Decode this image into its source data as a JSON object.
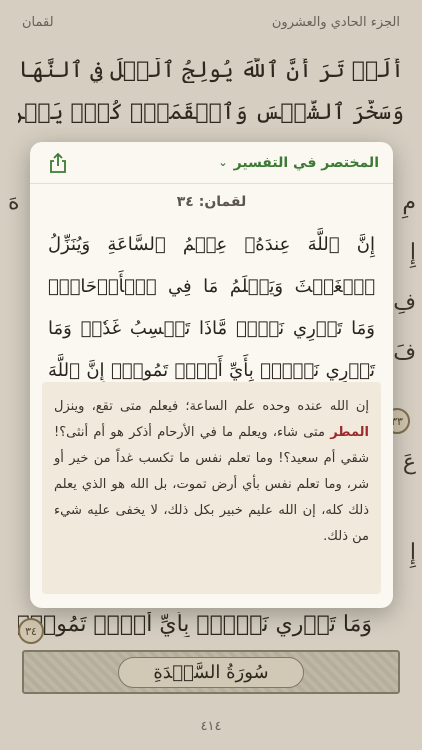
{
  "header": {
    "juz_title": "الجزء الحادي والعشرون",
    "surah_name": "لقمان"
  },
  "background_lines": [
    "أَلَمۡ تَرَ أَنَّ ٱللَّهَ يُولِجُ ٱلَّيۡلَ فِي ٱلنَّهَارِ وَيُولِجُ ٱلنَّهَارَ فِي ٱلَّيۡلِ",
    "وَسَخَّرَ ٱلشَّمۡسَ وَٱلۡقَمَرَۖ كُلّٞ يَجۡرِيٓ إِلَىٰٓ أَجَلٖ مُّسَمّٗى وَأَنَّ ٱللَّهَ",
    "وَمَا تَدۡرِي نَفۡسُۢ بِأَيِّ أَرۡضٖ تَمُوتُۚ إِنَّ ٱللَّهَ عَلِيمٌ خَبِيرُۢ"
  ],
  "background_verse_marker": "٣٤",
  "surah_banner": "سُورَةُ السَّجۡدَةِ",
  "page_number": "٤١٤",
  "popup": {
    "tafsir_name": "المختصر في التفسير",
    "chevron_icon": "chevron-down-icon",
    "share_icon": "share-icon",
    "verse_reference": "لقمان: ٣٤",
    "verse_text": "إِنَّ ٱللَّهَ عِندَهُۥ عِلۡمُ ٱلسَّاعَةِ وَيُنَزِّلُ ٱلۡغَيۡثَ وَيَعۡلَمُ مَا فِي ٱلۡأَرۡحَامِۖ وَمَا تَدۡرِي نَفۡسٞ مَّاذَا تَكۡسِبُ غَدٗاۖ وَمَا تَدۡرِي نَفۡسُۢ بِأَيِّ أَرۡضٖ تَمُوتُۚ إِنَّ ٱللَّهَ عَلِيمٌ خَبِيرُۢ",
    "tafsir_before": "إن الله عنده وحده علم الساعة؛ فيعلم متى تقع، وينزل ",
    "tafsir_highlight": "المطر",
    "tafsir_after": " متى شاء، ويعلم ما في الأرحام أذكر هو أم أنثى؟! شقي أم سعيد؟! وما تعلم نفس ما تكسب غداً من خير أو شر، وما تعلم نفس بأي أرض تموت، بل الله هو الذي يعلم ذلك كله، إن الله عليم خبير بكل ذلك، لا يخفى عليه شيء من ذلك."
  },
  "colors": {
    "accent_green": "#3c7a35",
    "highlight_red": "#9b2b2b",
    "page_bg": "#f4eee2"
  }
}
